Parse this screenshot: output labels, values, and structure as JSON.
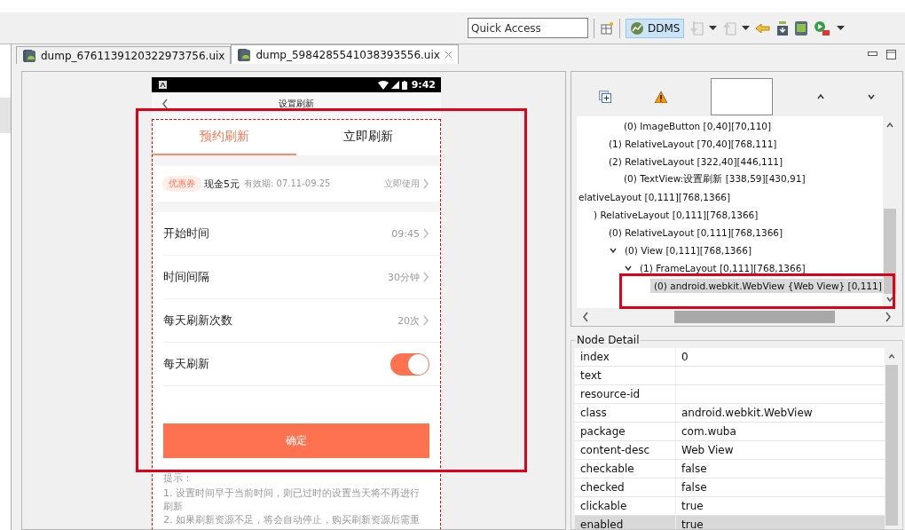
{
  "toolbar": {
    "quick_access": {
      "placeholder": "Quick Access"
    },
    "perspective": {
      "label": "DDMS",
      "selected": true
    }
  },
  "editor_tabs": [
    {
      "label": "dump_6761139120322973756.uix",
      "selected": false
    },
    {
      "label": "dump_5984285541038393556.uix",
      "selected": true
    }
  ],
  "phone": {
    "status_time": "9:42",
    "title": "设置刷新",
    "tabs": [
      {
        "label": "预约刷新",
        "selected": true
      },
      {
        "label": "立即刷新",
        "selected": false
      }
    ],
    "coupon": {
      "tag": "优惠券",
      "amount": "现金5元",
      "validity": "有效期: 07.11-09.25",
      "action": "立即使用"
    },
    "settings": [
      {
        "kind": "value",
        "label": "开始时间",
        "value": "09:45"
      },
      {
        "kind": "value",
        "label": "时间间隔",
        "value": "30分钟"
      },
      {
        "kind": "value",
        "label": "每天刷新次数",
        "value": "20次"
      },
      {
        "kind": "switch",
        "label": "每天刷新",
        "on": true
      }
    ],
    "confirm_button": "确定",
    "tips_title": "提示：",
    "tips": [
      "1. 设置时间早于当前时间，则已过时的设置当天将不再进行刷新",
      "2. 如果刷新资源不足，将会自动停止，购买刷新资源后需重"
    ]
  },
  "tree": {
    "items": [
      {
        "children": [
          {
            "children": [
              {
                "children": [
                  {
                    "label": "(0) ImageButton [0,40][70,110]",
                    "selected": false
                  }
                ]
              },
              {
                "label": "(1) RelativeLayout [70,40][768,111]",
                "selected": false
              },
              {
                "label": "(2) RelativeLayout [322,40][446,111]",
                "selected": false,
                "children": [
                  {
                    "label": "(0) TextView:设置刷新 [338,59][430,91]",
                    "selected": false
                  }
                ]
              }
            ]
          }
        ]
      },
      {
        "label": "elativeLayout [0,111][768,1366]",
        "selected": false,
        "children": [
          {
            "label": ") RelativeLayout [0,111][768,1366]",
            "selected": false,
            "children": [
              {
                "label": "(0) RelativeLayout [0,111][768,1366]",
                "selected": false,
                "children": [
                  {
                    "label": "(0) View [0,111][768,1366]",
                    "selected": false,
                    "expanded": true,
                    "children": [
                      {
                        "label": "(1) FrameLayout [0,111][768,1366]",
                        "selected": false,
                        "expanded": true,
                        "children": [
                          {
                            "label": "(0) android.webkit.WebView {Web View} [0,111]",
                            "selected": true
                          }
                        ]
                      }
                    ]
                  }
                ]
              }
            ]
          }
        ]
      }
    ]
  },
  "node_detail": {
    "title": "Node Detail",
    "rows": [
      {
        "key": "index",
        "value": "0",
        "selected": false
      },
      {
        "key": "text",
        "selected": false
      },
      {
        "key": "resource-id",
        "selected": false
      },
      {
        "key": "class",
        "value": "android.webkit.WebView",
        "selected": false
      },
      {
        "key": "package",
        "value": "com.wuba",
        "selected": false
      },
      {
        "key": "content-desc",
        "value": "Web View",
        "selected": false
      },
      {
        "key": "checkable",
        "value": "false",
        "selected": false
      },
      {
        "key": "checked",
        "value": "false",
        "selected": false
      },
      {
        "key": "clickable",
        "value": "true",
        "selected": false
      },
      {
        "key": "enabled",
        "value": "true",
        "selected": true
      }
    ]
  }
}
